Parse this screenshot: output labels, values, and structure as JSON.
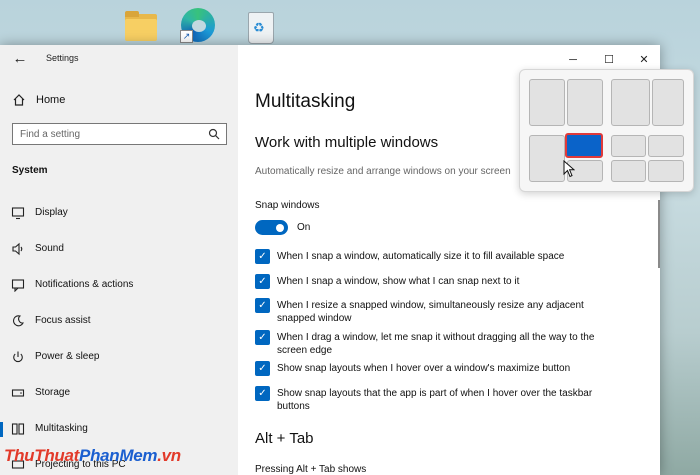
{
  "window": {
    "title": "Settings"
  },
  "sidebar": {
    "home_label": "Home",
    "search_placeholder": "Find a setting",
    "section": "System",
    "items": [
      {
        "label": "Display",
        "icon": "monitor-icon"
      },
      {
        "label": "Sound",
        "icon": "speaker-icon"
      },
      {
        "label": "Notifications & actions",
        "icon": "notification-icon"
      },
      {
        "label": "Focus assist",
        "icon": "moon-icon"
      },
      {
        "label": "Power & sleep",
        "icon": "power-icon"
      },
      {
        "label": "Storage",
        "icon": "storage-icon"
      },
      {
        "label": "Multitasking",
        "icon": "multitasking-icon",
        "active": true
      },
      {
        "label": "Projecting to this PC",
        "icon": "projector-icon"
      }
    ]
  },
  "main": {
    "page_title": "Multitasking",
    "section1_title": "Work with multiple windows",
    "section1_desc": "Automatically resize and arrange windows on your screen",
    "snap_label": "Snap windows",
    "snap_state": "On",
    "checkboxes": [
      {
        "text": "When I snap a window, automatically size it to fill available space",
        "checked": true
      },
      {
        "text": "When I snap a window, show what I can snap next to it",
        "checked": true
      },
      {
        "text": "When I resize a snapped window, simultaneously resize any adjacent snapped window",
        "checked": true
      },
      {
        "text": "When I drag a window, let me snap it without dragging all the way to the screen edge",
        "checked": true
      },
      {
        "text": "Show snap layouts when I hover over a window's maximize button",
        "checked": true
      },
      {
        "text": "Show snap layouts that the app is part of when I hover over the taskbar buttons",
        "checked": true
      }
    ],
    "section2_title": "Alt + Tab",
    "section2_sub": "Pressing Alt + Tab shows"
  },
  "watermark": {
    "part1": "ThuThuat",
    "part2": "PhanMem",
    "part3": ".vn"
  },
  "colors": {
    "accent": "#0067c0",
    "highlight": "#e03a3a"
  }
}
